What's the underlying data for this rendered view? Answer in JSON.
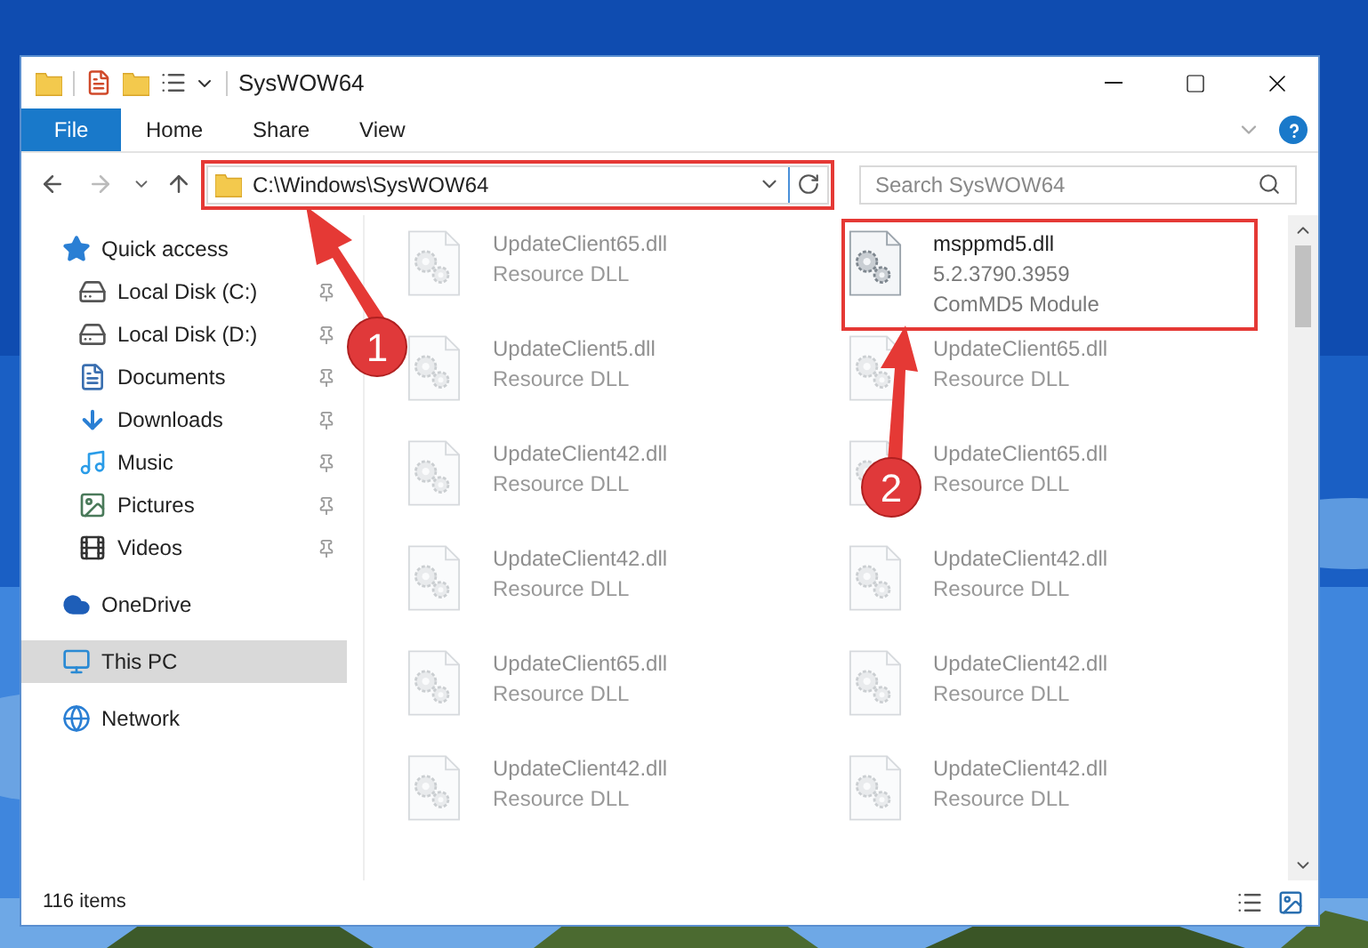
{
  "window": {
    "title": "SysWOW64"
  },
  "tabs": [
    {
      "label": "File",
      "kind": "file",
      "selected": false
    },
    {
      "label": "Home",
      "kind": "tab",
      "selected": false
    },
    {
      "label": "Share",
      "kind": "tab",
      "selected": false
    },
    {
      "label": "View",
      "kind": "tab",
      "selected": false
    }
  ],
  "address": {
    "path": "C:\\Windows\\SysWOW64",
    "search_placeholder": "Search SysWOW64"
  },
  "sidebar": {
    "items": [
      {
        "label": "Quick access",
        "selected": false,
        "children": [
          {
            "label": "Local Disk (C:)",
            "pinned": true,
            "selected": false
          },
          {
            "label": "Local Disk (D:)",
            "pinned": true,
            "selected": false
          },
          {
            "label": "Documents",
            "pinned": true,
            "selected": false
          },
          {
            "label": "Downloads",
            "pinned": true,
            "selected": false
          },
          {
            "label": "Music",
            "pinned": true,
            "selected": false
          },
          {
            "label": "Pictures",
            "pinned": true,
            "selected": false
          },
          {
            "label": "Videos",
            "pinned": true,
            "selected": false
          }
        ]
      },
      {
        "label": "OneDrive",
        "selected": false
      },
      {
        "label": "This PC",
        "selected": true
      },
      {
        "label": "Network",
        "selected": false
      }
    ]
  },
  "files": [
    {
      "name": "UpdateClient65.dll",
      "lines": [
        "Resource DLL"
      ],
      "blurred": true,
      "highlighted": false
    },
    {
      "name": "msppmd5.dll",
      "lines": [
        "5.2.3790.3959",
        "ComMD5 Module"
      ],
      "blurred": false,
      "highlighted": true
    },
    {
      "name": "UpdateClient5.dll",
      "lines": [
        "Resource DLL"
      ],
      "blurred": true,
      "highlighted": false
    },
    {
      "name": "UpdateClient65.dll",
      "lines": [
        "Resource DLL"
      ],
      "blurred": true,
      "highlighted": false
    },
    {
      "name": "UpdateClient42.dll",
      "lines": [
        "Resource DLL"
      ],
      "blurred": true,
      "highlighted": false
    },
    {
      "name": "UpdateClient65.dll",
      "lines": [
        "Resource DLL"
      ],
      "blurred": true,
      "highlighted": false
    },
    {
      "name": "UpdateClient42.dll",
      "lines": [
        "Resource DLL"
      ],
      "blurred": true,
      "highlighted": false
    },
    {
      "name": "UpdateClient42.dll",
      "lines": [
        "Resource DLL"
      ],
      "blurred": true,
      "highlighted": false
    },
    {
      "name": "UpdateClient65.dll",
      "lines": [
        "Resource DLL"
      ],
      "blurred": true,
      "highlighted": false
    },
    {
      "name": "UpdateClient42.dll",
      "lines": [
        "Resource DLL"
      ],
      "blurred": true,
      "highlighted": false
    },
    {
      "name": "UpdateClient42.dll",
      "lines": [
        "Resource DLL"
      ],
      "blurred": true,
      "highlighted": false
    },
    {
      "name": "UpdateClient42.dll",
      "lines": [
        "Resource DLL"
      ],
      "blurred": true,
      "highlighted": false
    }
  ],
  "status_bar": {
    "count": "116 items"
  },
  "annotations": [
    {
      "number": "1"
    },
    {
      "number": "2"
    }
  ]
}
